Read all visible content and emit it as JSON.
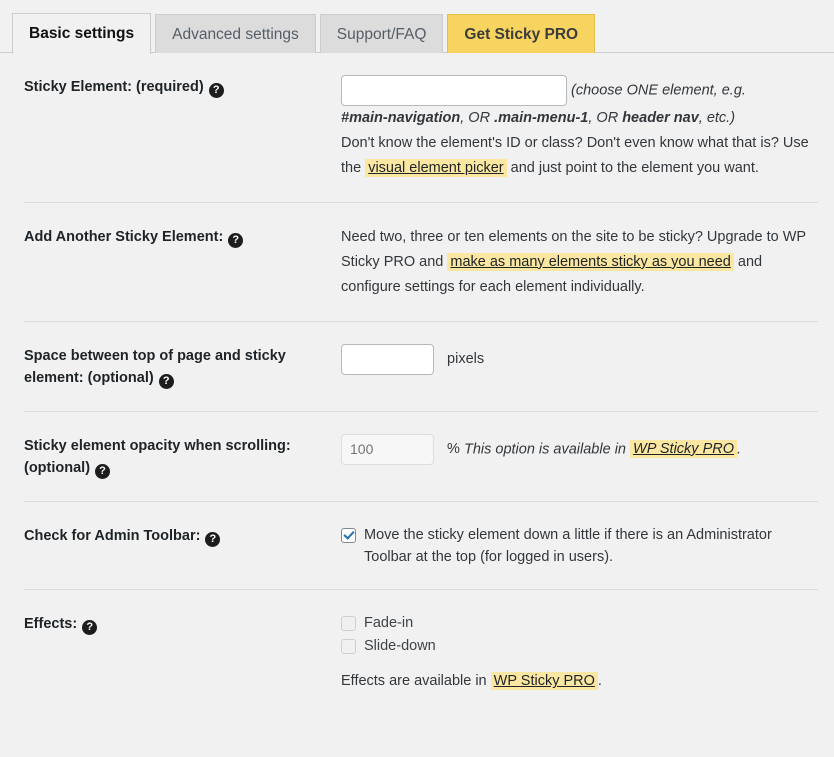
{
  "tabs": [
    {
      "label": "Basic settings",
      "state": "active"
    },
    {
      "label": "Advanced settings",
      "state": "inactive"
    },
    {
      "label": "Support/FAQ",
      "state": "inactive"
    },
    {
      "label": "Get Sticky PRO",
      "state": "pro"
    }
  ],
  "help_glyph": "?",
  "colors": {
    "pro_tab": "#f7d35f",
    "highlight": "#fbe7a1",
    "page_background": "#f1f1f1",
    "checkbox_check": "#2271b1"
  },
  "rows": {
    "sticky_element": {
      "label": "Sticky Element: (required)",
      "input_value": "",
      "input_placeholder": "",
      "hint_open": "(choose ONE element, e.g.",
      "example_1": "#main-navigation",
      "example_sep_1": ", OR ",
      "example_2": ".main-menu-1",
      "example_sep_2": ", OR ",
      "example_3": "header nav",
      "hint_close": ", etc.)",
      "desc_part1": "Don't know the element's ID or class? Don't even know what that is? Use the",
      "link": "visual element picker",
      "desc_part2": "and just point to the element you want."
    },
    "add_another": {
      "label": "Add Another Sticky Element:",
      "desc_part1": "Need two, three or ten elements on the site to be sticky? Upgrade to WP Sticky PRO and",
      "link": "make as many elements sticky as you need",
      "desc_part2": "and configure settings for each element individually."
    },
    "space_top": {
      "label": "Space between top of page and sticky element: (optional)",
      "input_value": "",
      "unit": "pixels"
    },
    "opacity": {
      "label": "Sticky element opacity when scrolling: (optional)",
      "input_placeholder": "100",
      "input_value": "",
      "percent": "%",
      "note": "This option is available in",
      "link": "WP Sticky PRO",
      "note_end": "."
    },
    "admin_toolbar": {
      "label": "Check for Admin Toolbar:",
      "checked": true,
      "text": "Move the sticky element down a little if there is an Administrator Toolbar at the top (for logged in users)."
    },
    "effects": {
      "label": "Effects:",
      "options": [
        {
          "label": "Fade-in",
          "checked": false,
          "disabled": true
        },
        {
          "label": "Slide-down",
          "checked": false,
          "disabled": true
        }
      ],
      "note": "Effects are available in",
      "link": "WP Sticky PRO",
      "note_end": "."
    }
  }
}
